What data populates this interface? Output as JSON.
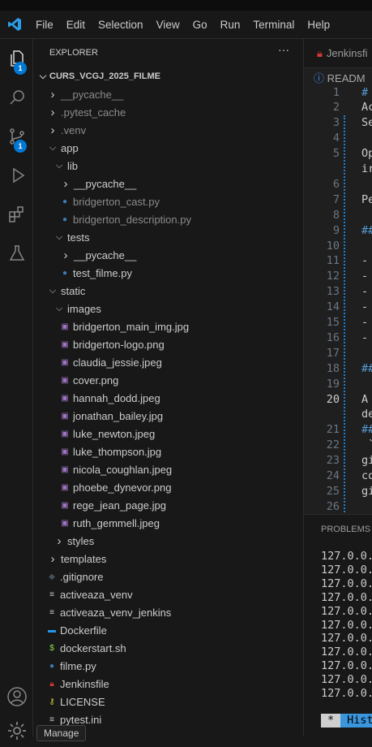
{
  "menu": [
    "File",
    "Edit",
    "Selection",
    "View",
    "Go",
    "Run",
    "Terminal",
    "Help"
  ],
  "activity": {
    "explorer_badge": "1",
    "scm_badge": "1"
  },
  "explorer": {
    "title": "EXPLORER",
    "more": "···",
    "root": "CURS_VCGJ_2025_FILME",
    "items": [
      {
        "label": "__pycache__",
        "type": "folder",
        "open": false,
        "level": 0,
        "dim": true
      },
      {
        "label": ".pytest_cache",
        "type": "folder",
        "open": false,
        "level": 0,
        "dim": true
      },
      {
        "label": ".venv",
        "type": "folder",
        "open": false,
        "level": 0,
        "dim": true
      },
      {
        "label": "app",
        "type": "folder",
        "open": true,
        "level": 0
      },
      {
        "label": "lib",
        "type": "folder",
        "open": true,
        "level": 1
      },
      {
        "label": "__pycache__",
        "type": "folder",
        "open": false,
        "level": 2
      },
      {
        "label": "bridgerton_cast.py",
        "type": "python",
        "level": 2,
        "dim": true
      },
      {
        "label": "bridgerton_description.py",
        "type": "python",
        "level": 2,
        "dim": true
      },
      {
        "label": "tests",
        "type": "folder",
        "open": true,
        "level": 1
      },
      {
        "label": "__pycache__",
        "type": "folder",
        "open": false,
        "level": 2
      },
      {
        "label": "test_filme.py",
        "type": "python",
        "level": 2
      },
      {
        "label": "static",
        "type": "folder",
        "open": true,
        "level": 0
      },
      {
        "label": "images",
        "type": "folder",
        "open": true,
        "level": 1
      },
      {
        "label": "bridgerton_main_img.jpg",
        "type": "image",
        "level": 2
      },
      {
        "label": "bridgerton-logo.png",
        "type": "image",
        "level": 2
      },
      {
        "label": "claudia_jessie.jpeg",
        "type": "image",
        "level": 2
      },
      {
        "label": "cover.png",
        "type": "image",
        "level": 2
      },
      {
        "label": "hannah_dodd.jpeg",
        "type": "image",
        "level": 2
      },
      {
        "label": "jonathan_bailey.jpg",
        "type": "image",
        "level": 2
      },
      {
        "label": "luke_newton.jpeg",
        "type": "image",
        "level": 2
      },
      {
        "label": "luke_thompson.jpg",
        "type": "image",
        "level": 2
      },
      {
        "label": "nicola_coughlan.jpeg",
        "type": "image",
        "level": 2
      },
      {
        "label": "phoebe_dynevor.png",
        "type": "image",
        "level": 2
      },
      {
        "label": "rege_jean_page.jpg",
        "type": "image",
        "level": 2
      },
      {
        "label": "ruth_gemmell.jpeg",
        "type": "image",
        "level": 2
      },
      {
        "label": "styles",
        "type": "folder",
        "open": false,
        "level": 1
      },
      {
        "label": "templates",
        "type": "folder",
        "open": false,
        "level": 0
      },
      {
        "label": ".gitignore",
        "type": "git",
        "level": 0
      },
      {
        "label": "activeaza_venv",
        "type": "text",
        "level": 0
      },
      {
        "label": "activeaza_venv_jenkins",
        "type": "text",
        "level": 0
      },
      {
        "label": "Dockerfile",
        "type": "docker",
        "level": 0
      },
      {
        "label": "dockerstart.sh",
        "type": "shell",
        "level": 0
      },
      {
        "label": "filme.py",
        "type": "python",
        "level": 0
      },
      {
        "label": "Jenkinsfile",
        "type": "jenkins",
        "level": 0
      },
      {
        "label": "LICENSE",
        "type": "license",
        "level": 0
      },
      {
        "label": "pytest.ini",
        "type": "text",
        "level": 0
      }
    ]
  },
  "editor": {
    "tab": "Jenkinsfi",
    "breadcrumb": "READM",
    "lines": [
      {
        "n": "1",
        "t": "# ",
        "h": true
      },
      {
        "n": "2",
        "t": "Ac"
      },
      {
        "n": "3",
        "t": "Se"
      },
      {
        "n": "4",
        "t": ""
      },
      {
        "n": "5",
        "t": "Op"
      },
      {
        "n": "",
        "t": "ir"
      },
      {
        "n": "6",
        "t": ""
      },
      {
        "n": "7",
        "t": "Pe"
      },
      {
        "n": "8",
        "t": ""
      },
      {
        "n": "9",
        "t": "##",
        "h": true
      },
      {
        "n": "10",
        "t": ""
      },
      {
        "n": "11",
        "t": "- "
      },
      {
        "n": "12",
        "t": "- "
      },
      {
        "n": "13",
        "t": "- "
      },
      {
        "n": "14",
        "t": "- "
      },
      {
        "n": "15",
        "t": "- "
      },
      {
        "n": "16",
        "t": "- "
      },
      {
        "n": "17",
        "t": ""
      },
      {
        "n": "18",
        "t": "##",
        "h": true
      },
      {
        "n": "19",
        "t": ""
      },
      {
        "n": "20",
        "t": "A ",
        "cur": true
      },
      {
        "n": "",
        "t": "de"
      },
      {
        "n": "21",
        "t": "##",
        "h": true
      },
      {
        "n": "22",
        "t": " `"
      },
      {
        "n": "23",
        "t": "gi"
      },
      {
        "n": "24",
        "t": "co"
      },
      {
        "n": "25",
        "t": "gi"
      },
      {
        "n": "26",
        "t": ""
      }
    ]
  },
  "panel": {
    "title": "PROBLEMS",
    "terminal_lines": [
      "127.0.0.",
      "127.0.0.",
      "127.0.0.",
      "127.0.0.",
      "127.0.0.",
      "127.0.0.",
      "127.0.0.",
      "127.0.0.",
      "127.0.0.",
      "127.0.0.",
      "127.0.0."
    ],
    "hist_star": "*",
    "hist_label": "Hist"
  },
  "tooltip": "Manage"
}
